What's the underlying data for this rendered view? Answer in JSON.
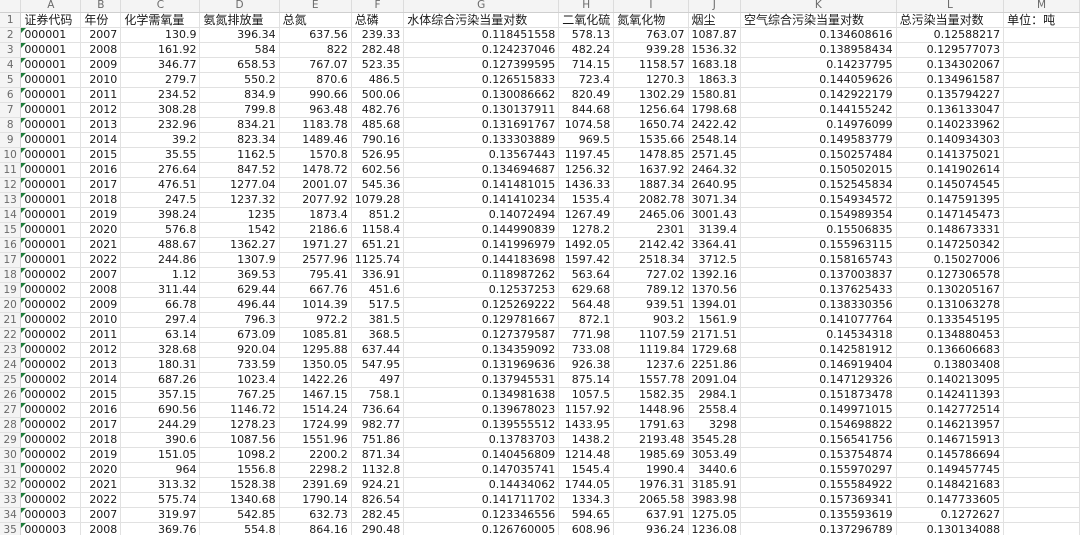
{
  "columns": [
    "A",
    "B",
    "C",
    "D",
    "E",
    "F",
    "G",
    "H",
    "I",
    "J",
    "K",
    "L",
    "M"
  ],
  "header": [
    "证券代码",
    "年份",
    "化学需氧量",
    "氨氮排放量",
    "总氮",
    "总磷",
    "水体综合污染当量对数",
    "二氧化硫",
    "氮氧化物",
    "烟尘",
    "空气综合污染当量对数",
    "总污染当量对数",
    "单位：吨"
  ],
  "rows": [
    [
      "000001",
      "2007",
      "130.9",
      "396.34",
      "637.56",
      "239.33",
      "0.118451558",
      "578.13",
      "763.07",
      "1087.87",
      "0.134608616",
      "0.12588217"
    ],
    [
      "000001",
      "2008",
      "161.92",
      "584",
      "822",
      "282.48",
      "0.124237046",
      "482.24",
      "939.28",
      "1536.32",
      "0.138958434",
      "0.129577073"
    ],
    [
      "000001",
      "2009",
      "346.77",
      "658.53",
      "767.07",
      "523.35",
      "0.127399595",
      "714.15",
      "1158.57",
      "1683.18",
      "0.14237795",
      "0.134302067"
    ],
    [
      "000001",
      "2010",
      "279.7",
      "550.2",
      "870.6",
      "486.5",
      "0.126515833",
      "723.4",
      "1270.3",
      "1863.3",
      "0.144059626",
      "0.134961587"
    ],
    [
      "000001",
      "2011",
      "234.52",
      "834.9",
      "990.66",
      "500.06",
      "0.130086662",
      "820.49",
      "1302.29",
      "1580.81",
      "0.142922179",
      "0.135794227"
    ],
    [
      "000001",
      "2012",
      "308.28",
      "799.8",
      "963.48",
      "482.76",
      "0.130137911",
      "844.68",
      "1256.64",
      "1798.68",
      "0.144155242",
      "0.136133047"
    ],
    [
      "000001",
      "2013",
      "232.96",
      "834.21",
      "1183.78",
      "485.68",
      "0.131691767",
      "1074.58",
      "1650.74",
      "2422.42",
      "0.14976099",
      "0.140233962"
    ],
    [
      "000001",
      "2014",
      "39.2",
      "823.34",
      "1489.46",
      "790.16",
      "0.133303889",
      "969.5",
      "1535.66",
      "2548.14",
      "0.149583779",
      "0.140934303"
    ],
    [
      "000001",
      "2015",
      "35.55",
      "1162.5",
      "1570.8",
      "526.95",
      "0.13567443",
      "1197.45",
      "1478.85",
      "2571.45",
      "0.150257484",
      "0.141375021"
    ],
    [
      "000001",
      "2016",
      "276.64",
      "847.52",
      "1478.72",
      "602.56",
      "0.134694687",
      "1256.32",
      "1637.92",
      "2464.32",
      "0.150502015",
      "0.141902614"
    ],
    [
      "000001",
      "2017",
      "476.51",
      "1277.04",
      "2001.07",
      "545.36",
      "0.141481015",
      "1436.33",
      "1887.34",
      "2640.95",
      "0.152545834",
      "0.145074545"
    ],
    [
      "000001",
      "2018",
      "247.5",
      "1237.32",
      "2077.92",
      "1079.28",
      "0.141410234",
      "1535.4",
      "2082.78",
      "3071.34",
      "0.154934572",
      "0.147591395"
    ],
    [
      "000001",
      "2019",
      "398.24",
      "1235",
      "1873.4",
      "851.2",
      "0.14072494",
      "1267.49",
      "2465.06",
      "3001.43",
      "0.154989354",
      "0.147145473"
    ],
    [
      "000001",
      "2020",
      "576.8",
      "1542",
      "2186.6",
      "1158.4",
      "0.144990839",
      "1278.2",
      "2301",
      "3139.4",
      "0.15506835",
      "0.148673331"
    ],
    [
      "000001",
      "2021",
      "488.67",
      "1362.27",
      "1971.27",
      "651.21",
      "0.141996979",
      "1492.05",
      "2142.42",
      "3364.41",
      "0.155963115",
      "0.147250342"
    ],
    [
      "000001",
      "2022",
      "244.86",
      "1307.9",
      "2577.96",
      "1125.74",
      "0.144183698",
      "1597.42",
      "2518.34",
      "3712.5",
      "0.158165743",
      "0.15027006"
    ],
    [
      "000002",
      "2007",
      "1.12",
      "369.53",
      "795.41",
      "336.91",
      "0.118987262",
      "563.64",
      "727.02",
      "1392.16",
      "0.137003837",
      "0.127306578"
    ],
    [
      "000002",
      "2008",
      "311.44",
      "629.44",
      "667.76",
      "451.6",
      "0.12537253",
      "629.68",
      "789.12",
      "1370.56",
      "0.137625433",
      "0.130205167"
    ],
    [
      "000002",
      "2009",
      "66.78",
      "496.44",
      "1014.39",
      "517.5",
      "0.125269222",
      "564.48",
      "939.51",
      "1394.01",
      "0.138330356",
      "0.131063278"
    ],
    [
      "000002",
      "2010",
      "297.4",
      "796.3",
      "972.2",
      "381.5",
      "0.129781667",
      "872.1",
      "903.2",
      "1561.9",
      "0.141077764",
      "0.133545195"
    ],
    [
      "000002",
      "2011",
      "63.14",
      "673.09",
      "1085.81",
      "368.5",
      "0.127379587",
      "771.98",
      "1107.59",
      "2171.51",
      "0.14534318",
      "0.134880453"
    ],
    [
      "000002",
      "2012",
      "328.68",
      "920.04",
      "1295.88",
      "637.44",
      "0.134359092",
      "733.08",
      "1119.84",
      "1729.68",
      "0.142581912",
      "0.136606683"
    ],
    [
      "000002",
      "2013",
      "180.31",
      "733.59",
      "1350.05",
      "547.95",
      "0.131969636",
      "926.38",
      "1237.6",
      "2251.86",
      "0.146919404",
      "0.13803408"
    ],
    [
      "000002",
      "2014",
      "687.26",
      "1023.4",
      "1422.26",
      "497",
      "0.137945531",
      "875.14",
      "1557.78",
      "2091.04",
      "0.147129326",
      "0.140213095"
    ],
    [
      "000002",
      "2015",
      "357.15",
      "767.25",
      "1467.15",
      "758.1",
      "0.134981638",
      "1057.5",
      "1582.35",
      "2984.1",
      "0.151873478",
      "0.142411393"
    ],
    [
      "000002",
      "2016",
      "690.56",
      "1146.72",
      "1514.24",
      "736.64",
      "0.139678023",
      "1157.92",
      "1448.96",
      "2558.4",
      "0.149971015",
      "0.142772514"
    ],
    [
      "000002",
      "2017",
      "244.29",
      "1278.23",
      "1724.99",
      "982.77",
      "0.139555512",
      "1433.95",
      "1791.63",
      "3298",
      "0.154698822",
      "0.146213957"
    ],
    [
      "000002",
      "2018",
      "390.6",
      "1087.56",
      "1551.96",
      "751.86",
      "0.13783703",
      "1438.2",
      "2193.48",
      "3545.28",
      "0.156541756",
      "0.146715913"
    ],
    [
      "000002",
      "2019",
      "151.05",
      "1098.2",
      "2200.2",
      "871.34",
      "0.140456809",
      "1214.48",
      "1985.69",
      "3053.49",
      "0.153754874",
      "0.145786694"
    ],
    [
      "000002",
      "2020",
      "964",
      "1556.8",
      "2298.2",
      "1132.8",
      "0.147035741",
      "1545.4",
      "1990.4",
      "3440.6",
      "0.155970297",
      "0.149457745"
    ],
    [
      "000002",
      "2021",
      "313.32",
      "1528.38",
      "2391.69",
      "924.21",
      "0.14434062",
      "1744.05",
      "1976.31",
      "3185.91",
      "0.155584922",
      "0.148421683"
    ],
    [
      "000002",
      "2022",
      "575.74",
      "1340.68",
      "1790.14",
      "826.54",
      "0.141711702",
      "1334.3",
      "2065.58",
      "3983.98",
      "0.157369341",
      "0.147733605"
    ],
    [
      "000003",
      "2007",
      "319.97",
      "542.85",
      "632.73",
      "282.45",
      "0.123346556",
      "594.65",
      "637.91",
      "1275.05",
      "0.135593619",
      "0.1272627"
    ],
    [
      "000003",
      "2008",
      "369.76",
      "554.8",
      "864.16",
      "290.48",
      "0.126760005",
      "608.96",
      "936.24",
      "1236.08",
      "0.137296789",
      "0.130134088"
    ]
  ]
}
